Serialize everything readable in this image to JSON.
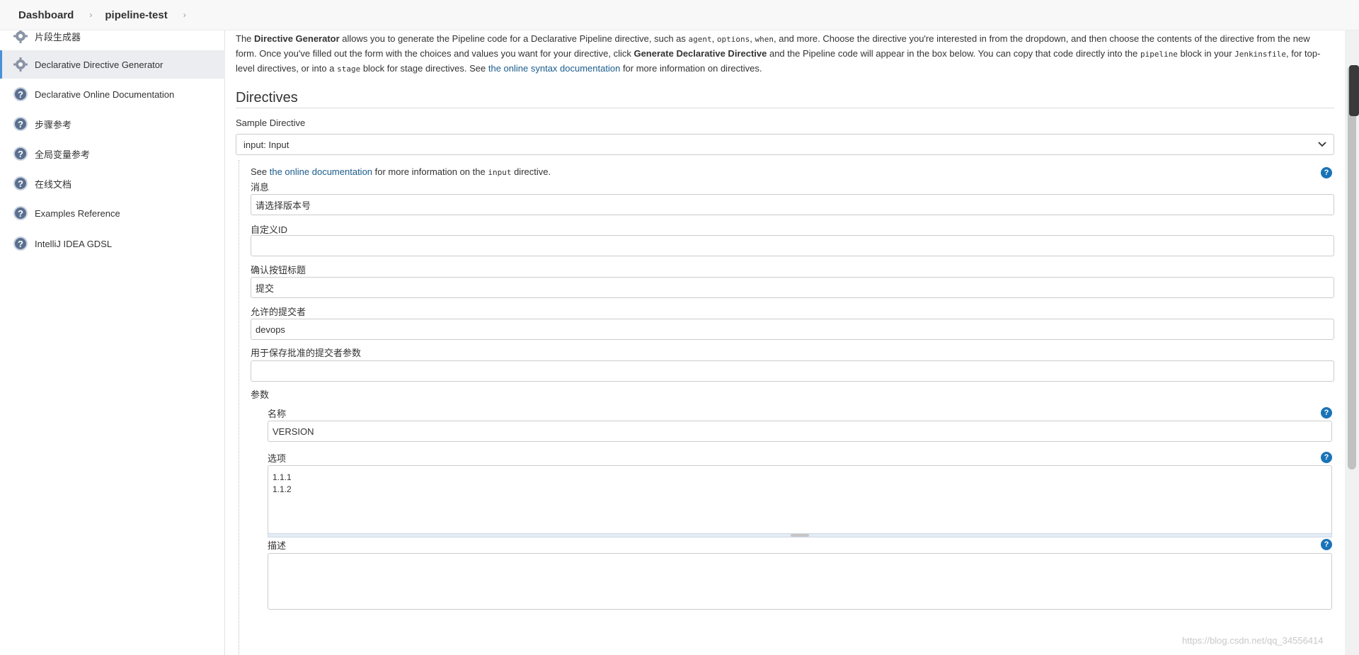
{
  "breadcrumb": {
    "items": [
      "Dashboard",
      "pipeline-test"
    ]
  },
  "sidebar": {
    "items": [
      {
        "label": "片段生成器",
        "icon": "gear-icon",
        "active": false
      },
      {
        "label": "Declarative Directive Generator",
        "icon": "gear-icon",
        "active": true
      },
      {
        "label": "Declarative Online Documentation",
        "icon": "help-icon",
        "active": false
      },
      {
        "label": "步骤参考",
        "icon": "help-icon",
        "active": false
      },
      {
        "label": "全局变量参考",
        "icon": "help-icon",
        "active": false
      },
      {
        "label": "在线文档",
        "icon": "help-icon",
        "active": false
      },
      {
        "label": "Examples Reference",
        "icon": "help-icon",
        "active": false
      },
      {
        "label": "IntelliJ IDEA GDSL",
        "icon": "help-icon",
        "active": false
      }
    ]
  },
  "intro": {
    "t1": "The ",
    "b1": "Directive Generator",
    "t2": " allows you to generate the Pipeline code for a Declarative Pipeline directive, such as ",
    "c1": "agent",
    "t3": ", ",
    "c2": "options",
    "t4": ", ",
    "c3": "when",
    "t5": ", and more. Choose the directive you're interested in from the dropdown, and then choose the contents of the directive from the new form. Once you've filled out the form with the choices and values you want for your directive, click ",
    "b2": "Generate Declarative Directive",
    "t6": " and the Pipeline code will appear in the box below. You can copy that code directly into the ",
    "c4": "pipeline",
    "t7": " block in your ",
    "c5": "Jenkinsfile",
    "t8": ", for top-level directives, or into a ",
    "c6": "stage",
    "t9": " block for stage directives. See ",
    "link": "the online syntax documentation",
    "t10": " for more information on directives."
  },
  "main": {
    "section_title": "Directives",
    "sample_directive_label": "Sample Directive",
    "sample_directive_value": "input: Input"
  },
  "directive_form": {
    "see_text": "See ",
    "doc_link": "the online documentation",
    "more_text": " for more information on the ",
    "code": "input",
    "end_text": " directive.",
    "message_label": "消息",
    "message_value": "请选择版本号",
    "id_label": "自定义ID",
    "id_value": "",
    "ok_label": "确认按钮标题",
    "ok_value": "提交",
    "submitter_label": "允许的提交者",
    "submitter_value": "devops",
    "submitter_param_label": "用于保存批准的提交者参数",
    "submitter_param_value": "",
    "params_label": "参数",
    "param_name_label": "名称",
    "param_name_value": "VERSION",
    "choices_label": "选项",
    "choices_value": "1.1.1\n1.1.2",
    "description_label": "描述",
    "description_value": ""
  },
  "watermark": "https://blog.csdn.net/qq_34556414"
}
